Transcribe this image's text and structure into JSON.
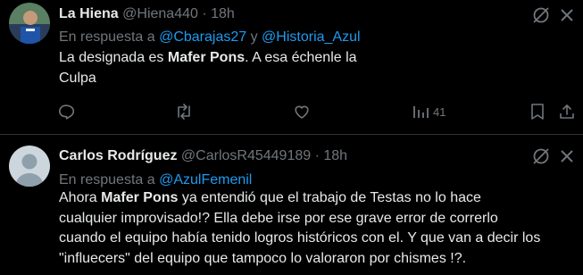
{
  "tweets": [
    {
      "author_name": "La Hiena",
      "handle": "@Hiena440",
      "separator": "·",
      "time": "18h",
      "reply_prefix": "En respuesta a ",
      "mention_1": "@Cbarajas27",
      "reply_joiner": " y ",
      "mention_2": "@Historia_Azul",
      "body_line1_pre": "La designada es ",
      "body_line1_bold": "Mafer Pons",
      "body_line1_post": ". A esa échenle la",
      "body_line2": "Culpa",
      "views": "41"
    },
    {
      "author_name": "Carlos Rodríguez",
      "handle": "@CarlosR45449189",
      "separator": "·",
      "time": "18h",
      "reply_prefix": "En respuesta a ",
      "mention_1": "@AzulFemenil",
      "body_line1_pre": "Ahora ",
      "body_line1_bold": "Mafer Pons",
      "body_line1_post": " ya entendió que el trabajo de Testas no lo hace",
      "body_line2": "cualquier improvisado!? Ella debe irse por ese grave error de correrlo",
      "body_line3": "cuando el equipo había tenido logros históricos con el. Y que van a decir los",
      "body_line4": "\"influecers\" del equipo que tampoco lo valoraron por chismes !?."
    }
  ],
  "icons": {
    "reply": "reply-icon",
    "retweet": "retweet-icon",
    "like": "like-icon",
    "views": "views-icon",
    "bookmark": "bookmark-icon",
    "share": "share-icon",
    "grok": "grok-icon",
    "more": "more-icon"
  },
  "colors": {
    "background": "#000000",
    "text": "#e7e9ea",
    "secondary": "#71767b",
    "link": "#1d9bf0",
    "divider": "#2f3336"
  }
}
